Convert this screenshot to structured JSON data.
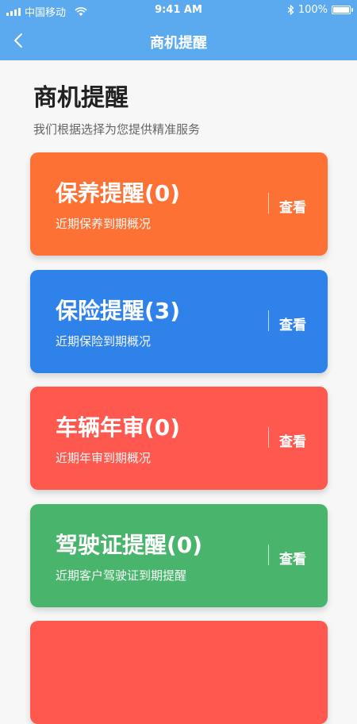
{
  "status": {
    "carrier": "中国移动",
    "time": "9:41 AM",
    "battery": "100%",
    "battery_level": 1.0
  },
  "nav": {
    "title": "商机提醒"
  },
  "header": {
    "title": "商机提醒",
    "subtitle": "我们根据选择为您提供精准服务"
  },
  "cards": [
    {
      "title": "保养提醒(0)",
      "subtitle": "近期保养到期概况",
      "action": "查看",
      "color": "#fe7134"
    },
    {
      "title": "保险提醒(3)",
      "subtitle": "近期保险到期概况",
      "action": "查看",
      "color": "#2f82ea"
    },
    {
      "title": "车辆年审(0)",
      "subtitle": "近期年审到期概况",
      "action": "查看",
      "color": "#fe584f"
    },
    {
      "title": "驾驶证提醒(0)",
      "subtitle": "近期客户驾驶证到期提醒",
      "action": "查看",
      "color": "#49b46c"
    },
    {
      "title": "",
      "subtitle": "",
      "action": "",
      "color": "#fe584f"
    }
  ]
}
